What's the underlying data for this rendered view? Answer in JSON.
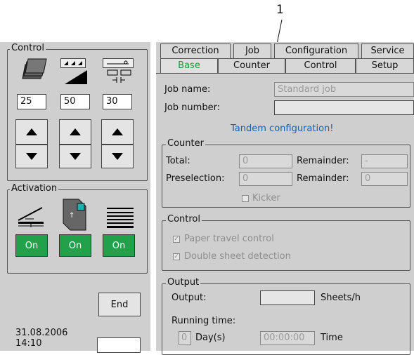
{
  "callout": {
    "number": "1"
  },
  "control": {
    "legend": "Control",
    "values": [
      "25",
      "50",
      "30"
    ]
  },
  "activation": {
    "legend": "Activation",
    "buttons": [
      "On",
      "On",
      "On"
    ]
  },
  "footer": {
    "end_label": "End",
    "date": "31.08.2006",
    "time": "14:10"
  },
  "tabs": {
    "top": [
      "Correction",
      "Job",
      "Configuration",
      "Service"
    ],
    "bottom": [
      "Base",
      "Counter",
      "Control",
      "Setup"
    ]
  },
  "job": {
    "name_label": "Job name:",
    "name_value": "Standard job",
    "number_label": "Job number:",
    "number_value": "",
    "message": "Tandem configuration!"
  },
  "counter": {
    "legend": "Counter",
    "total_label": "Total:",
    "total_value": "0",
    "remainder1_label": "Remainder:",
    "remainder1_value": "-",
    "preselection_label": "Preselection:",
    "preselection_value": "0",
    "remainder2_label": "Remainder:",
    "remainder2_value": "0",
    "kicker_label": "Kicker"
  },
  "controlgrp": {
    "legend": "Control",
    "paper_label": "Paper travel control",
    "double_label": "Double sheet detection"
  },
  "output": {
    "legend": "Output",
    "output_label": "Output:",
    "output_value": "",
    "unit": "Sheets/h",
    "running_label": "Running time:",
    "days_value": "0",
    "days_label": "Day(s)",
    "time_value": "00:00:00",
    "time_label": "Time"
  },
  "colors": {
    "panel": "#cfcfcf",
    "on_button": "#22a04a",
    "message": "#1f5fa0"
  }
}
